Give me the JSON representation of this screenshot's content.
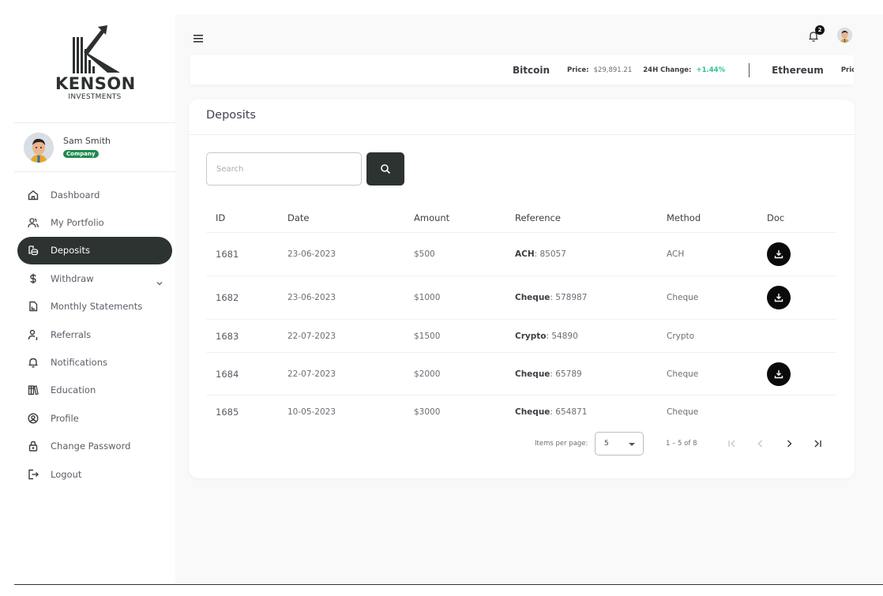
{
  "brand": {
    "name": "KENSON",
    "tagline": "INVESTMENTS"
  },
  "user": {
    "name": "Sam Smith",
    "badge": "Company"
  },
  "sidebar": {
    "items": [
      {
        "label": "Dashboard",
        "icon": "home-icon",
        "active": false
      },
      {
        "label": "My Portfolio",
        "icon": "users-icon",
        "active": false
      },
      {
        "label": "Deposits",
        "icon": "coins-icon",
        "active": true
      },
      {
        "label": "Withdraw",
        "icon": "dollar-icon",
        "active": false,
        "expandable": true
      },
      {
        "label": "Monthly Statements",
        "icon": "file-chart-icon",
        "active": false
      },
      {
        "label": "Referrals",
        "icon": "user-referral-icon",
        "active": false
      },
      {
        "label": "Notifications",
        "icon": "bell-icon",
        "active": false
      },
      {
        "label": "Education",
        "icon": "books-icon",
        "active": false
      },
      {
        "label": "Profile",
        "icon": "user-circle-icon",
        "active": false
      },
      {
        "label": "Change Password",
        "icon": "lock-icon",
        "active": false
      },
      {
        "label": "Logout",
        "icon": "logout-icon",
        "active": false
      }
    ]
  },
  "header": {
    "notification_count": "2"
  },
  "ticker": [
    {
      "coin": "Bitcoin",
      "price_label": "Price:",
      "price": "$29,891.21",
      "change_label": "24H Change:",
      "change": "+1.44%"
    },
    {
      "coin": "Ethereum",
      "price_label": "Price:"
    }
  ],
  "page": {
    "title": "Deposits",
    "search_placeholder": "Search",
    "columns": [
      "ID",
      "Date",
      "Amount",
      "Reference",
      "Method",
      "Doc"
    ],
    "rows": [
      {
        "id": "1681",
        "date": "23-06-2023",
        "amount": "$500",
        "ref_type": "ACH",
        "ref_num": ": 85057",
        "method": "ACH",
        "doc": true
      },
      {
        "id": "1682",
        "date": "23-06-2023",
        "amount": "$1000",
        "ref_type": "Cheque",
        "ref_num": ": 578987",
        "method": "Cheque",
        "doc": true
      },
      {
        "id": "1683",
        "date": "22-07-2023",
        "amount": "$1500",
        "ref_type": "Crypto",
        "ref_num": ": 54890",
        "method": "Crypto",
        "doc": false
      },
      {
        "id": "1684",
        "date": "22-07-2023",
        "amount": "$2000",
        "ref_type": "Cheque",
        "ref_num": ": 65789",
        "method": "Cheque",
        "doc": true
      },
      {
        "id": "1685",
        "date": "10-05-2023",
        "amount": "$3000",
        "ref_type": "Cheque",
        "ref_num": ": 654871",
        "method": "Cheque",
        "doc": false
      }
    ],
    "pagination": {
      "items_per_page_label": "Items per page:",
      "items_per_page": "5",
      "range": "1 – 5 of 8"
    }
  },
  "colors": {
    "accent_dark": "#2c3331",
    "badge_green": "#1f8a4e",
    "change_up": "#2ec28a"
  }
}
